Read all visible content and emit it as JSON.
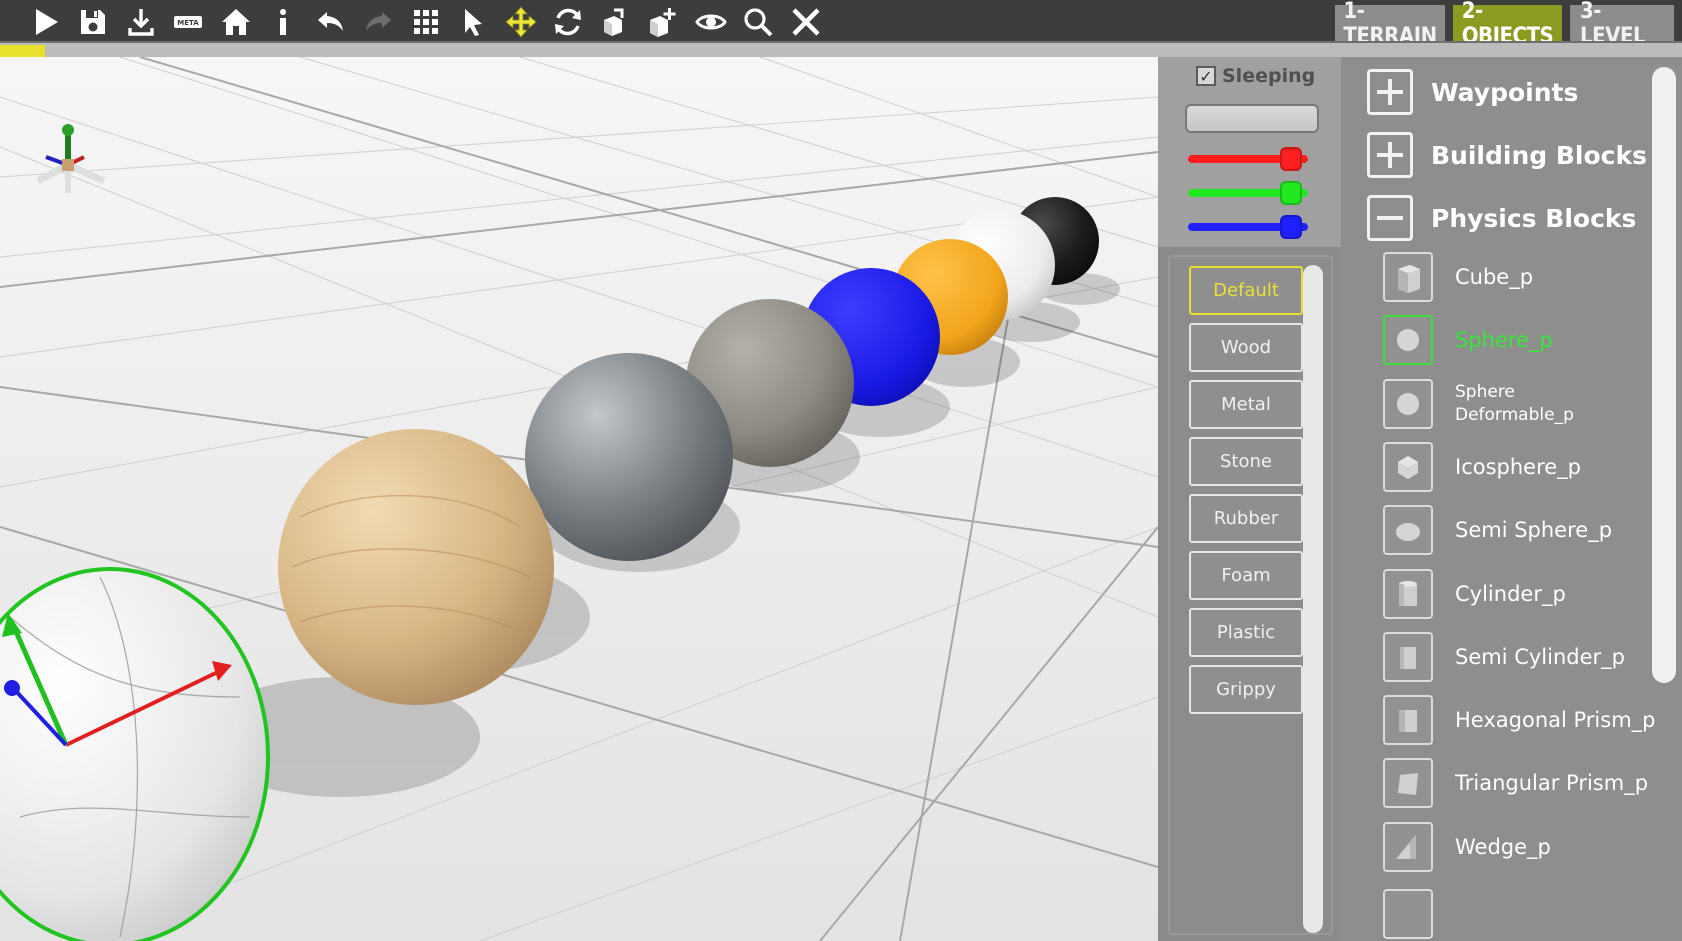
{
  "toolbar": {
    "tools": [
      {
        "name": "play-icon"
      },
      {
        "name": "save-icon"
      },
      {
        "name": "download-icon"
      },
      {
        "name": "meta-icon",
        "label": "META"
      },
      {
        "name": "home-icon"
      },
      {
        "name": "info-icon"
      },
      {
        "name": "undo-icon"
      },
      {
        "name": "redo-icon"
      },
      {
        "name": "grid-icon"
      },
      {
        "name": "select-arrow-icon"
      },
      {
        "name": "move-icon"
      },
      {
        "name": "rotate-icon"
      },
      {
        "name": "scale-icon"
      },
      {
        "name": "add-object-icon"
      },
      {
        "name": "eye-icon"
      },
      {
        "name": "search-icon"
      },
      {
        "name": "close-icon"
      }
    ],
    "level_tabs": [
      {
        "label": "1-TERRAIN",
        "active": false
      },
      {
        "label": "2-OBJECTS",
        "active": true
      },
      {
        "label": "3-LEVEL",
        "active": false
      }
    ],
    "progress_fraction": 0.027
  },
  "properties": {
    "sleeping_label": "Sleeping",
    "sleeping_checked": true,
    "check_mark": "✓",
    "color_sliders": [
      {
        "name": "red",
        "color": "#ff1f1f",
        "value": 0.86
      },
      {
        "name": "green",
        "color": "#21e821",
        "value": 0.86
      },
      {
        "name": "blue",
        "color": "#1f1fff",
        "value": 0.86
      }
    ],
    "materials": [
      "Default",
      "Wood",
      "Metal",
      "Stone",
      "Rubber",
      "Foam",
      "Plastic",
      "Grippy"
    ],
    "selected_material": "Default"
  },
  "catalog": {
    "categories": [
      {
        "label": "Waypoints",
        "expanded": false
      },
      {
        "label": "Building Blocks",
        "expanded": false
      },
      {
        "label": "Physics Blocks",
        "expanded": true
      }
    ],
    "items": [
      {
        "label": "Cube_p",
        "icon": "cube-icon"
      },
      {
        "label": "Sphere_p",
        "icon": "sphere-icon",
        "active": true
      },
      {
        "label": "Sphere Deformable_p",
        "line1": "Sphere",
        "line2": "Deformable_p",
        "icon": "sphere-deformable-icon"
      },
      {
        "label": "Icosphere_p",
        "icon": "icosphere-icon"
      },
      {
        "label": "Semi Sphere_p",
        "icon": "semi-sphere-icon"
      },
      {
        "label": "Cylinder_p",
        "icon": "cylinder-icon"
      },
      {
        "label": "Semi Cylinder_p",
        "icon": "semi-cylinder-icon"
      },
      {
        "label": "Hexagonal Prism_p",
        "icon": "hexagonal-prism-icon"
      },
      {
        "label": "Triangular Prism_p",
        "icon": "triangular-prism-icon"
      },
      {
        "label": "Wedge_p",
        "icon": "wedge-icon"
      }
    ]
  },
  "scene": {
    "objects": [
      {
        "name": "selected-deformable-sphere",
        "color": "#e4e4e4"
      },
      {
        "name": "wood-sphere",
        "color": "#d9b98a"
      },
      {
        "name": "metal-sphere",
        "color": "#7d8286"
      },
      {
        "name": "stone-sphere",
        "color": "#8e8c84"
      },
      {
        "name": "blue-sphere",
        "color": "#1616e0"
      },
      {
        "name": "orange-sphere",
        "color": "#f2a51c"
      },
      {
        "name": "white-sphere",
        "color": "#f0f0f0"
      },
      {
        "name": "black-sphere",
        "color": "#1a1a1a"
      }
    ]
  }
}
